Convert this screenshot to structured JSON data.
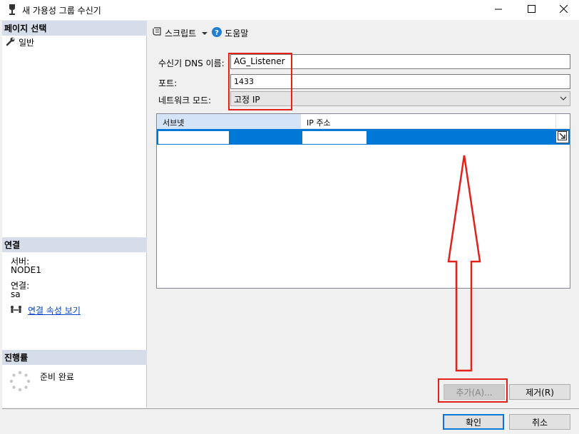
{
  "window": {
    "title": "새 가용성 그룹 수신기",
    "icon": "database-server-icon",
    "controls": [
      "minimize-icon",
      "maximize-icon",
      "close-icon"
    ]
  },
  "left_panel": {
    "page_select_header": "페이지 선택",
    "pages": [
      {
        "label": "일반",
        "icon": "wrench-icon"
      }
    ],
    "connection_header": "연결",
    "server_label": "서버:",
    "server_value": "NODE1",
    "connection_label": "연결:",
    "connection_value": "sa",
    "view_connection_properties": "연결 속성 보기",
    "progress_header": "진행률",
    "progress_status": "준비 완료"
  },
  "toolbar": {
    "script_label": "스크립트",
    "help_label": "도움말"
  },
  "form": {
    "dns_label": "수신기 DNS 이름:",
    "dns_value": "AG_Listener",
    "port_label": "포트:",
    "port_value": "1433",
    "network_mode_label": "네트워크 모드:",
    "network_mode_value": "고정 IP"
  },
  "grid": {
    "columns": [
      "서브넷",
      "IP 주소"
    ],
    "rows": [
      {
        "subnet": "",
        "ip": "",
        "selected": true
      }
    ]
  },
  "buttons": {
    "add": "추가(A)...",
    "remove": "제거(R)",
    "ok": "확인",
    "cancel": "취소"
  },
  "annotation": {
    "color": "#e32119"
  }
}
